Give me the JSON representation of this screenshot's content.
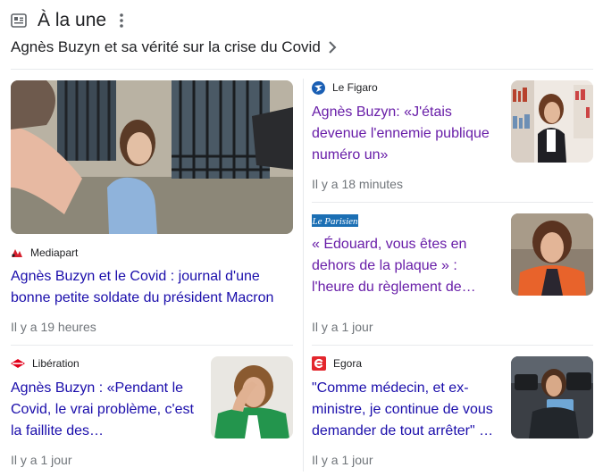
{
  "header": {
    "title": "À la une",
    "subtitle": "Agnès Buzyn et sa vérité sur la crise du Covid"
  },
  "articles": [
    {
      "source": "Mediapart",
      "headline": "Agnès Buzyn et le Covid : journal d'une bonne petite soldate du président Macron",
      "time": "Il y a 19 heures"
    },
    {
      "source": "Le Figaro",
      "headline": "Agnès Buzyn: «J'étais devenue l'ennemie publique numéro un»",
      "time": "Il y a 18 minutes"
    },
    {
      "source": "Le Parisien",
      "headline": "« Édouard, vous êtes en dehors de la plaque » : l'heure du règlement de…",
      "time": "Il y a 1 jour"
    },
    {
      "source": "Libération",
      "headline": "Agnès Buzyn : «Pendant le Covid, le vrai problème, c'est la faillite des…",
      "time": "Il y a 1 jour"
    },
    {
      "source": "Egora",
      "headline": "\"Comme médecin, et ex-ministre, je continue de vous demander de tout arrêter\" …",
      "time": "Il y a 1 jour"
    }
  ],
  "colors": {
    "link": "#1a0dab",
    "visited": "#681da8",
    "meta": "#70757a",
    "divider": "#e8eaed"
  }
}
